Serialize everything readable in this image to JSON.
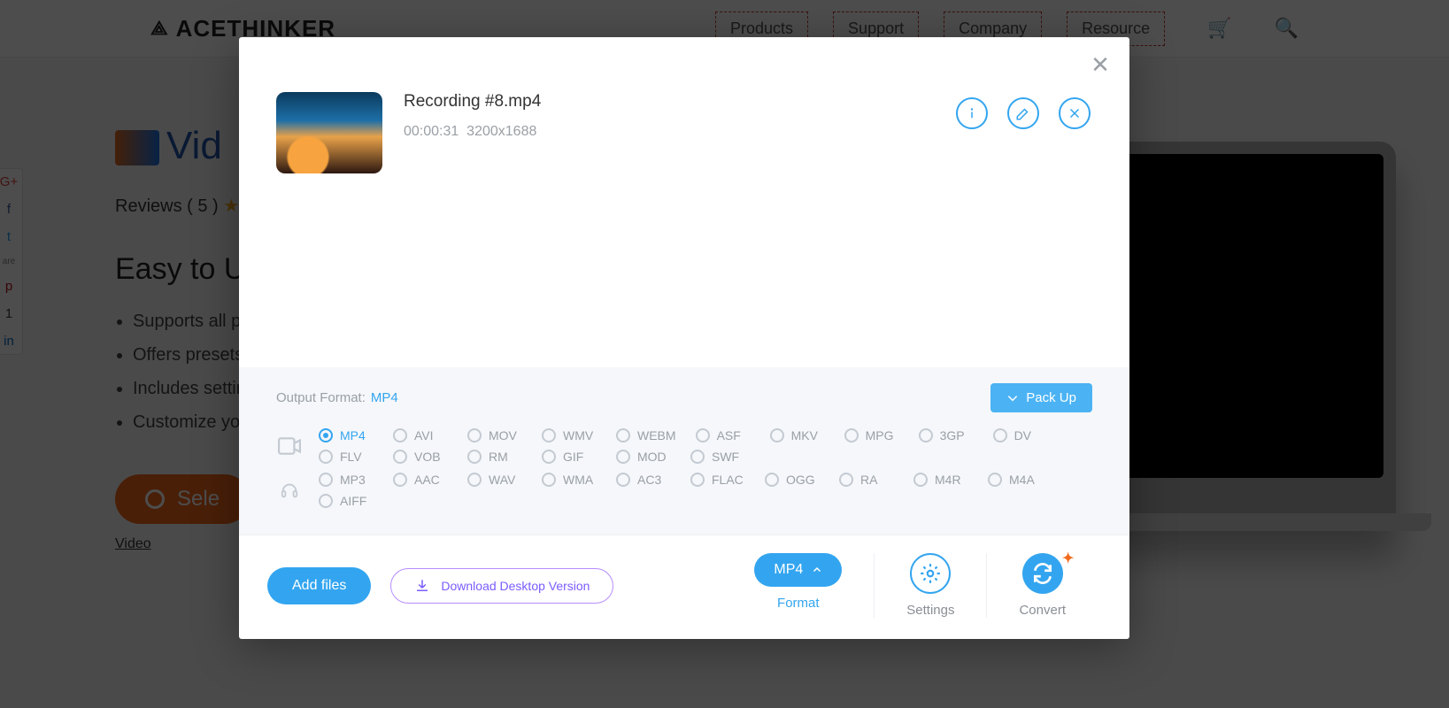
{
  "brand": "ACETHINKER",
  "nav": {
    "items": [
      "Products",
      "Support",
      "Company",
      "Resource"
    ]
  },
  "page": {
    "title_partial": "Vid",
    "reviews_label": "Reviews ( 5 )",
    "heading_partial": "Easy to Use",
    "bullets": [
      "Supports all p",
      "Offers presets",
      "Includes settin",
      "Customize you"
    ],
    "select_partial": "Sele",
    "small_link_partial": "Video"
  },
  "share_icons": [
    "G+",
    "f",
    "t",
    "are",
    "p",
    "1",
    "in"
  ],
  "modal": {
    "file": {
      "name": "Recording #8.mp4",
      "duration": "00:00:31",
      "resolution": "3200x1688"
    },
    "output_label": "Output Format:",
    "output_value": "MP4",
    "packup_label": "Pack Up",
    "video_formats": [
      "MP4",
      "AVI",
      "MOV",
      "WMV",
      "WEBM",
      "ASF",
      "MKV",
      "MPG",
      "3GP",
      "DV",
      "FLV",
      "VOB",
      "RM",
      "GIF",
      "MOD",
      "SWF"
    ],
    "audio_formats": [
      "MP3",
      "AAC",
      "WAV",
      "WMA",
      "AC3",
      "FLAC",
      "OGG",
      "RA",
      "M4R",
      "M4A",
      "AIFF"
    ],
    "selected_format": "MP4",
    "add_files": "Add files",
    "download_desktop": "Download Desktop Version",
    "format_chip": "MP4",
    "format_label": "Format",
    "settings_label": "Settings",
    "convert_label": "Convert"
  }
}
